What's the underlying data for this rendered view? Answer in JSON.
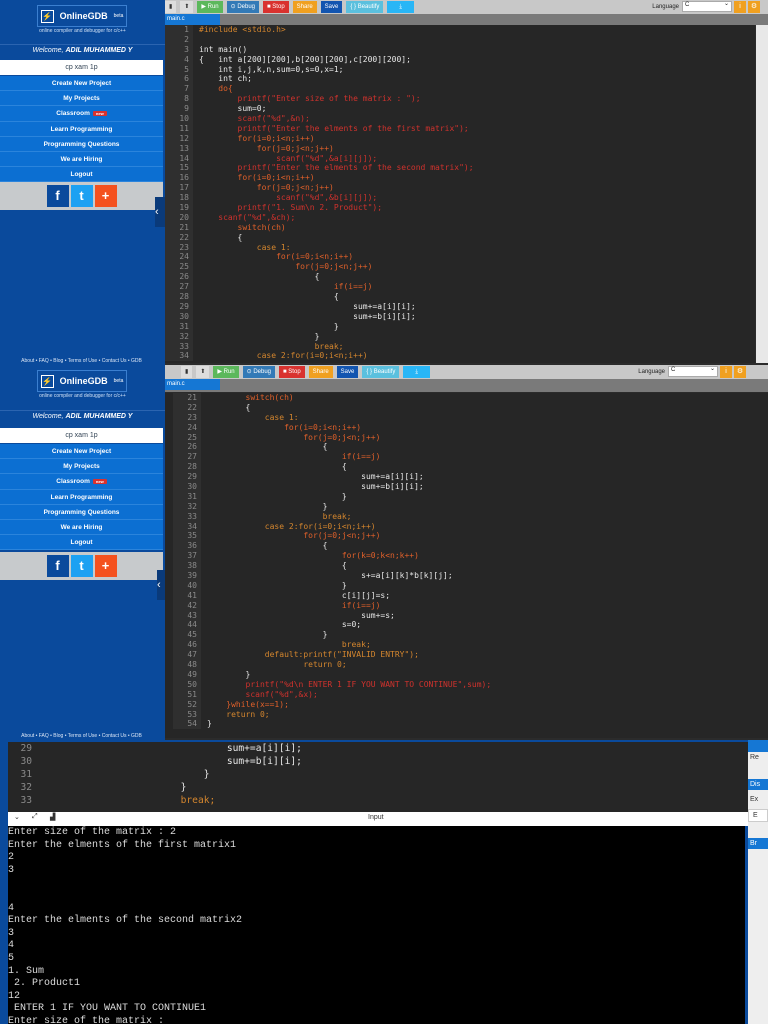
{
  "app": {
    "name": "OnlineGDB",
    "beta": "beta",
    "subtitle": "online compiler and debugger for c/c++"
  },
  "user": {
    "welcome": "Welcome,",
    "name": "ADIL MUHAMMED Y"
  },
  "project_name": "cp xam 1p",
  "menu": [
    {
      "label": "Create New Project"
    },
    {
      "label": "My Projects"
    },
    {
      "label": "Classroom",
      "badge": "new"
    },
    {
      "label": "Learn Programming"
    },
    {
      "label": "Programming Questions"
    },
    {
      "label": "We are Hiring"
    },
    {
      "label": "Logout"
    }
  ],
  "social": {
    "facebook": "f",
    "twitter": "t",
    "more": "+"
  },
  "footer": "About • FAQ • Blog • Terms of Use • Contact Us • GDB",
  "toolbar": {
    "run": "▶ Run",
    "debug": "⊙ Debug",
    "stop": "■ Stop",
    "share": "Share",
    "save": "Save",
    "beautify": "{ } Beautify",
    "download": "⤓",
    "language_label": "Language",
    "language": "C"
  },
  "colors": {
    "sidebar": "#0a4a9c",
    "run": "#5cb85c",
    "debug": "#337ab7",
    "stop": "#d9322f",
    "share": "#f0a020",
    "save": "#1255b0",
    "beautify": "#5bc0de",
    "download": "#29b6f6"
  },
  "file_tab": "main.c",
  "code": [
    "#include <stdio.h>",
    "",
    "int main()",
    "{   int a[200][200],b[200][200],c[200][200];",
    "    int i,j,k,n,sum=0,s=0,x=1;",
    "    int ch;",
    "    do{",
    "        printf(\"Enter size of the matrix : \");",
    "        sum=0;",
    "        scanf(\"%d\",&n);",
    "        printf(\"Enter the elments of the first matrix\");",
    "        for(i=0;i<n;i++)",
    "            for(j=0;j<n;j++)",
    "                scanf(\"%d\",&a[i][j]);",
    "        printf(\"Enter the elments of the second matrix\");",
    "        for(i=0;i<n;i++)",
    "            for(j=0;j<n;j++)",
    "                scanf(\"%d\",&b[i][j]);",
    "        printf(\"1. Sum\\n 2. Product\");",
    "    scanf(\"%d\",&ch);",
    "        switch(ch)",
    "        {",
    "            case 1:",
    "                for(i=0;i<n;i++)",
    "                    for(j=0;j<n;j++)",
    "                        {",
    "                            if(i==j)",
    "                            {",
    "                                sum+=a[i][i];",
    "                                sum+=b[i][i];",
    "                            }",
    "                        }",
    "                        break;",
    "            case 2:for(i=0;i<n;i++)",
    "                    for(j=0;j<n;j++)",
    "                        {",
    "                            for(k=0;k<n;k++)",
    "                            {",
    "                                s+=a[i][k]*b[k][j];",
    "                            }",
    "                            c[i][j]=s;",
    "                            if(i==j)",
    "                                sum+=s;",
    "                            s=0;",
    "                        }",
    "                            break;",
    "            default:printf(\"INVALID ENTRY\");",
    "                    return 0;",
    "        }",
    "        printf(\"%d\\n ENTER 1 IF YOU WANT TO CONTINUE\",sum);",
    "        scanf(\"%d\",&x);",
    "    }while(x==1);",
    "    return 0;",
    "}"
  ],
  "io": {
    "label": "Input"
  },
  "console": [
    "Enter size of the matrix : 2",
    "Enter the elments of the first matrix1",
    "2",
    "3",
    "",
    "",
    "4",
    "Enter the elments of the second matrix2",
    "3",
    "4",
    "5",
    "1. Sum",
    " 2. Product1",
    "12",
    " ENTER 1 IF YOU WANT TO CONTINUE1",
    "Enter size of the matrix :"
  ],
  "right_panel": [
    "Re",
    "Dis",
    "Ex",
    "E",
    "Br"
  ]
}
